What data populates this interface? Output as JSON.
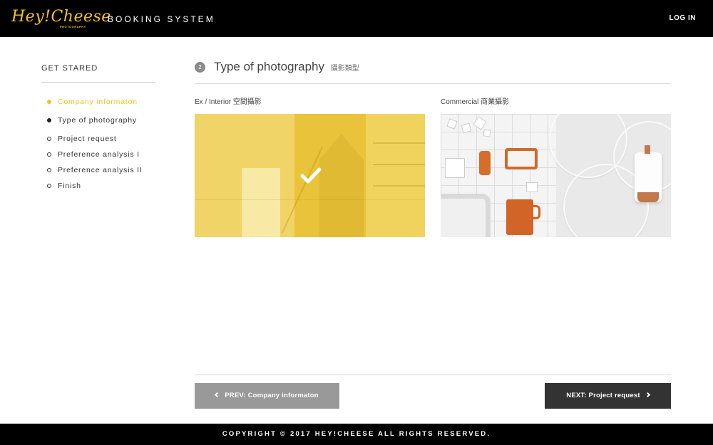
{
  "header": {
    "logo_text": "Hey!Cheese",
    "logo_sub": "PHOTOGRAPHY",
    "app_title": "BOOKING SYSTEM",
    "login_label": "LOG IN"
  },
  "sidebar": {
    "title": "GET STARED",
    "steps": [
      {
        "label": "Company informaton",
        "state": "done"
      },
      {
        "label": "Type of photography",
        "state": "current"
      },
      {
        "label": "Project request",
        "state": "todo"
      },
      {
        "label": "Preference analysis I",
        "state": "todo"
      },
      {
        "label": "Preference analysis II",
        "state": "todo"
      },
      {
        "label": "Finish",
        "state": "todo"
      }
    ]
  },
  "main": {
    "step_number": "2",
    "title": "Type of photography",
    "subtitle": "攝影類型",
    "options": [
      {
        "label": "Ex / Interior 空間攝影",
        "selected": true,
        "overlay_color": "#f3c12a"
      },
      {
        "label": "Commercial 商業攝影",
        "selected": false
      }
    ]
  },
  "nav": {
    "prev_label": "PREV: Company informaton",
    "next_label": "NEXT: Project request"
  },
  "footer": {
    "copyright": "COPYRIGHT © 2017 HEY!CHEESE ALL RIGHTS RESERVED."
  },
  "colors": {
    "accent": "#f3c12a",
    "header_bg": "#000000",
    "prev_button": "#999999",
    "next_button": "#333333"
  }
}
